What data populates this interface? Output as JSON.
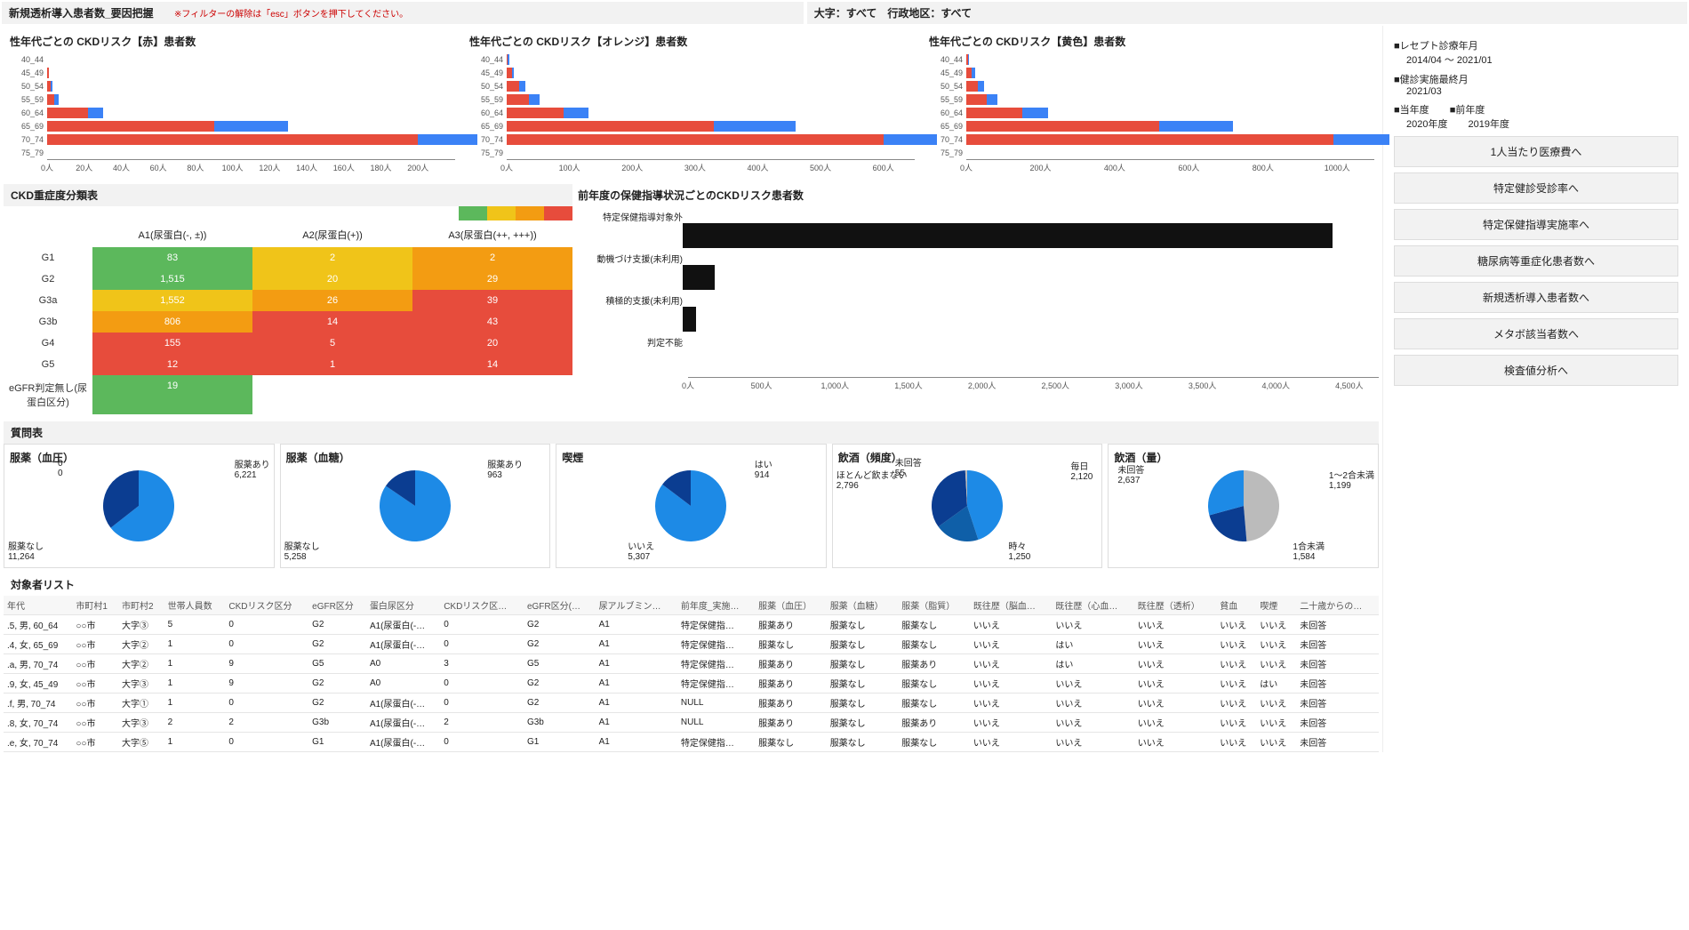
{
  "header": {
    "title": "新規透析導入患者数_要因把握",
    "filter_note": "※フィルターの解除は「esc」ボタンを押下してください。",
    "filters_label": "大字：すべて　行政地区：すべて"
  },
  "side": {
    "meta": [
      {
        "k": "■レセプト診療年月",
        "v": "2014/04 ～ 2021/01"
      },
      {
        "k": "■健診実施最終月",
        "v": "2021/03"
      }
    ],
    "years": {
      "cur_k": "■当年度",
      "cur_v": "2020年度",
      "prev_k": "■前年度",
      "prev_v": "2019年度"
    },
    "nav": [
      "1人当たり医療費へ",
      "特定健診受診率へ",
      "特定保健指導実施率へ",
      "糖尿病等重症化患者数へ",
      "新規透析導入患者数へ",
      "メタボ該当者数へ",
      "検査値分析へ"
    ]
  },
  "risk_charts": [
    {
      "title": "性年代ごとの CKDリスク【赤】患者数",
      "max": 220,
      "ticks": [
        0,
        20,
        40,
        60,
        80,
        100,
        120,
        140,
        160,
        180,
        200
      ],
      "unit": "人"
    },
    {
      "title": "性年代ごとの CKDリスク【オレンジ】患者数",
      "max": 650,
      "ticks": [
        0,
        100,
        200,
        300,
        400,
        500,
        600
      ],
      "unit": "人"
    },
    {
      "title": "性年代ごとの CKDリスク【黄色】患者数",
      "max": 1100,
      "ticks": [
        0,
        200,
        400,
        600,
        800,
        1000
      ],
      "unit": "人"
    }
  ],
  "chart_data": {
    "risk_bars": {
      "type": "bar",
      "orientation": "horizontal",
      "ages": [
        "40_44",
        "45_49",
        "50_54",
        "55_59",
        "60_64",
        "65_69",
        "70_74",
        "75_79"
      ],
      "series_names": [
        "前年度",
        "当年度"
      ],
      "colors": {
        "前年度": "#e74c3c",
        "当年度": "#3b82f6"
      },
      "charts": [
        {
          "name": "赤",
          "prev": [
            0,
            1,
            2,
            4,
            22,
            90,
            200,
            0
          ],
          "cur": [
            0,
            0,
            1,
            2,
            8,
            40,
            32,
            0
          ]
        },
        {
          "name": "オレンジ",
          "prev": [
            2,
            8,
            20,
            35,
            90,
            330,
            600,
            0
          ],
          "cur": [
            2,
            4,
            10,
            18,
            40,
            130,
            85,
            0
          ]
        },
        {
          "name": "黄色",
          "prev": [
            5,
            15,
            30,
            55,
            150,
            520,
            990,
            0
          ],
          "cur": [
            3,
            8,
            18,
            30,
            70,
            200,
            150,
            0
          ]
        }
      ]
    },
    "guidance_bar": {
      "type": "bar",
      "orientation": "horizontal",
      "title": "前年度の保健指導状況ごとのCKDリスク患者数",
      "xlabel": "人",
      "xmax": 4700,
      "ticks": [
        0,
        500,
        1000,
        1500,
        2000,
        2500,
        3000,
        3500,
        4000,
        4500
      ],
      "categories": [
        "特定保健指導対象外",
        "動機づけ支援(未利用)",
        "積極的支援(未利用)",
        "判定不能"
      ],
      "values": [
        4500,
        220,
        90,
        0
      ],
      "color": "#111"
    },
    "pies": [
      {
        "name": "服薬（血圧）",
        "slices": [
          {
            "l": "服薬なし",
            "v": 11264,
            "c": "#1d8ae6"
          },
          {
            "l": "服薬あり",
            "v": 6221,
            "c": "#0b3d91"
          },
          {
            "l": "0",
            "v": 0,
            "c": "#888"
          }
        ]
      },
      {
        "name": "服薬（血糖）",
        "slices": [
          {
            "l": "服薬なし",
            "v": 5258,
            "c": "#1d8ae6"
          },
          {
            "l": "服薬あり",
            "v": 963,
            "c": "#0b3d91"
          }
        ]
      },
      {
        "name": "喫煙",
        "slices": [
          {
            "l": "いいえ",
            "v": 5307,
            "c": "#1d8ae6"
          },
          {
            "l": "はい",
            "v": 914,
            "c": "#0b3d91"
          }
        ]
      },
      {
        "name": "飲酒（頻度）",
        "slices": [
          {
            "l": "ほとんど飲まない",
            "v": 2796,
            "c": "#1d8ae6"
          },
          {
            "l": "時々",
            "v": 1250,
            "c": "#0f5fa8"
          },
          {
            "l": "毎日",
            "v": 2120,
            "c": "#0b3d91"
          },
          {
            "l": "未回答",
            "v": 55,
            "c": "#bbb"
          }
        ]
      },
      {
        "name": "飲酒（量）",
        "slices": [
          {
            "l": "未回答",
            "v": 2637,
            "c": "#bbb"
          },
          {
            "l": "1～2合未満",
            "v": 1199,
            "c": "#0b3d91"
          },
          {
            "l": "1合未満",
            "v": 1584,
            "c": "#1d8ae6"
          }
        ]
      }
    ]
  },
  "severity": {
    "title": "CKD重症度分類表",
    "cols": [
      "A1(尿蛋白(-, ±))",
      "A2(尿蛋白(+))",
      "A3(尿蛋白(++, +++))"
    ],
    "rows": [
      {
        "l": "G1",
        "c": [
          {
            "v": "83",
            "k": "g"
          },
          {
            "v": "2",
            "k": "y"
          },
          {
            "v": "2",
            "k": "o"
          }
        ]
      },
      {
        "l": "G2",
        "c": [
          {
            "v": "1,515",
            "k": "g"
          },
          {
            "v": "20",
            "k": "y"
          },
          {
            "v": "29",
            "k": "o"
          }
        ]
      },
      {
        "l": "G3a",
        "c": [
          {
            "v": "1,552",
            "k": "y"
          },
          {
            "v": "26",
            "k": "o"
          },
          {
            "v": "39",
            "k": "r"
          }
        ]
      },
      {
        "l": "G3b",
        "c": [
          {
            "v": "806",
            "k": "o"
          },
          {
            "v": "14",
            "k": "r"
          },
          {
            "v": "43",
            "k": "r"
          }
        ]
      },
      {
        "l": "G4",
        "c": [
          {
            "v": "155",
            "k": "r"
          },
          {
            "v": "5",
            "k": "r"
          },
          {
            "v": "20",
            "k": "r"
          }
        ]
      },
      {
        "l": "G5",
        "c": [
          {
            "v": "12",
            "k": "r"
          },
          {
            "v": "1",
            "k": "r"
          },
          {
            "v": "14",
            "k": "r"
          }
        ]
      },
      {
        "l": "eGFR判定無し(尿蛋白区分)",
        "c": [
          {
            "v": "19",
            "k": "g"
          },
          {
            "v": "",
            "k": ""
          },
          {
            "v": "",
            "k": ""
          }
        ]
      }
    ]
  },
  "q_title": "質問表",
  "pie_titles": [
    "服薬（血圧）",
    "服薬（血糖）",
    "喫煙",
    "飲酒（頻度）",
    "飲酒（量）"
  ],
  "list": {
    "title": "対象者リスト",
    "cols": [
      "年代",
      "市町村1",
      "市町村2",
      "世帯人員数",
      "CKDリスク区分",
      "eGFR区分",
      "蛋白尿区分",
      "CKDリスク区…",
      "eGFR区分(…",
      "尿アルブミン…",
      "前年度_実施…",
      "服薬（血圧）",
      "服薬（血糖）",
      "服薬（脂質）",
      "既往歴（脳血…",
      "既往歴（心血…",
      "既往歴（透析）",
      "貧血",
      "喫煙",
      "二十歳からの…"
    ],
    "rows": [
      [
        ".5, 男, 60_64",
        "○○市",
        "大字③",
        "5",
        "0",
        "G2",
        "A1(尿蛋白(-…",
        "0",
        "G2",
        "A1",
        "特定保健指…",
        "服薬あり",
        "服薬なし",
        "服薬なし",
        "いいえ",
        "いいえ",
        "いいえ",
        "いいえ",
        "いいえ",
        "未回答"
      ],
      [
        ".4, 女, 65_69",
        "○○市",
        "大字②",
        "1",
        "0",
        "G2",
        "A1(尿蛋白(-…",
        "0",
        "G2",
        "A1",
        "特定保健指…",
        "服薬なし",
        "服薬なし",
        "服薬なし",
        "いいえ",
        "はい",
        "いいえ",
        "いいえ",
        "いいえ",
        "未回答"
      ],
      [
        ".a, 男, 70_74",
        "○○市",
        "大字②",
        "1",
        "9",
        "G5",
        "A0",
        "3",
        "G5",
        "A1",
        "特定保健指…",
        "服薬あり",
        "服薬なし",
        "服薬あり",
        "いいえ",
        "はい",
        "いいえ",
        "いいえ",
        "いいえ",
        "未回答"
      ],
      [
        ".9, 女, 45_49",
        "○○市",
        "大字③",
        "1",
        "9",
        "G2",
        "A0",
        "0",
        "G2",
        "A1",
        "特定保健指…",
        "服薬あり",
        "服薬なし",
        "服薬なし",
        "いいえ",
        "いいえ",
        "いいえ",
        "いいえ",
        "はい",
        "未回答"
      ],
      [
        ".f, 男, 70_74",
        "○○市",
        "大字①",
        "1",
        "0",
        "G2",
        "A1(尿蛋白(-…",
        "0",
        "G2",
        "A1",
        "NULL",
        "服薬あり",
        "服薬なし",
        "服薬なし",
        "いいえ",
        "いいえ",
        "いいえ",
        "いいえ",
        "いいえ",
        "未回答"
      ],
      [
        ".8, 女, 70_74",
        "○○市",
        "大字③",
        "2",
        "2",
        "G3b",
        "A1(尿蛋白(-…",
        "2",
        "G3b",
        "A1",
        "NULL",
        "服薬あり",
        "服薬なし",
        "服薬あり",
        "いいえ",
        "いいえ",
        "いいえ",
        "いいえ",
        "いいえ",
        "未回答"
      ],
      [
        ".e, 女, 70_74",
        "○○市",
        "大字⑤",
        "1",
        "0",
        "G1",
        "A1(尿蛋白(-…",
        "0",
        "G1",
        "A1",
        "特定保健指…",
        "服薬なし",
        "服薬なし",
        "服薬なし",
        "いいえ",
        "いいえ",
        "いいえ",
        "いいえ",
        "いいえ",
        "未回答"
      ]
    ]
  }
}
